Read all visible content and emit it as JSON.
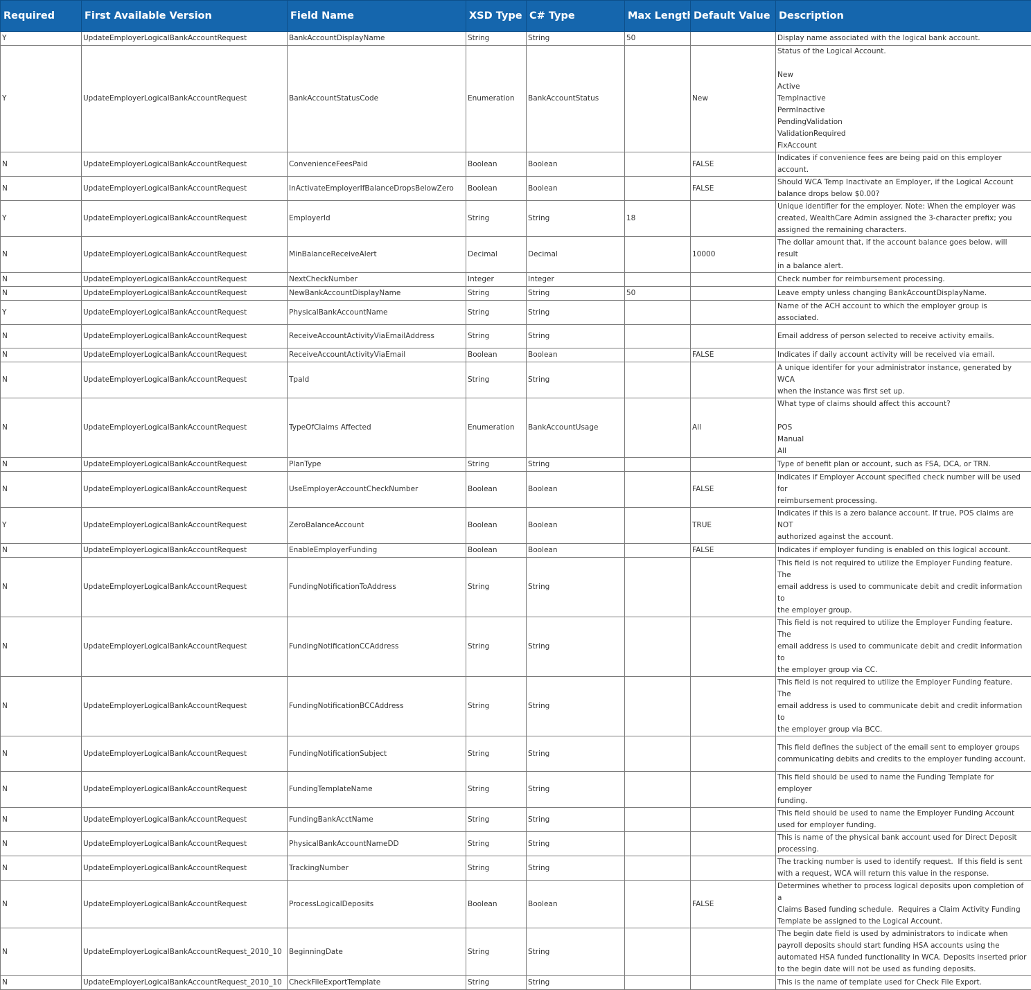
{
  "columns": [
    "Required",
    "First Available Version",
    "Field Name",
    "XSD Type",
    "C# Type",
    "Max Length",
    "Default Value",
    "Description"
  ],
  "rows": [
    {
      "h": 20,
      "cells": [
        "Y",
        "UpdateEmployerLogicalBankAccountRequest",
        "BankAccountDisplayName",
        "String",
        "String",
        "50",
        "",
        "Display name associated with the logical bank account."
      ]
    },
    {
      "h": 153,
      "cells": [
        "Y",
        "UpdateEmployerLogicalBankAccountRequest",
        "BankAccountStatusCode",
        "Enumeration",
        "BankAccountStatus",
        "",
        "New",
        "Status of the Logical Account.\n\nNew\nActive\nTempInactive\nPermInactive\nPendingValidation\nValidationRequired\nFixAccount"
      ]
    },
    {
      "h": 34,
      "cells": [
        "N",
        "UpdateEmployerLogicalBankAccountRequest",
        "ConvenienceFeesPaid",
        "Boolean",
        "Boolean",
        "",
        "FALSE",
        "Indicates if convenience fees are being paid on this employer account."
      ]
    },
    {
      "h": 34,
      "cells": [
        "N",
        "UpdateEmployerLogicalBankAccountRequest",
        "InActivateEmployerIfBalanceDropsBelowZero",
        "Boolean",
        "Boolean",
        "",
        "FALSE",
        "Should WCA Temp Inactivate an Employer, if the Logical Account\nbalance drops below $0.00?"
      ]
    },
    {
      "h": 51,
      "cells": [
        "Y",
        "UpdateEmployerLogicalBankAccountRequest",
        "EmployerId",
        "String",
        "String",
        "18",
        "",
        "Unique identifier for the employer. Note: When the employer was\ncreated, WealthCare Admin assigned the 3-character prefix; you\nassigned the remaining characters."
      ]
    },
    {
      "h": 34,
      "cells": [
        "N",
        "UpdateEmployerLogicalBankAccountRequest",
        "MinBalanceReceiveAlert",
        "Decimal",
        "Decimal",
        "",
        "10000",
        "The dollar amount that, if the account balance goes below, will result\nin a balance alert."
      ]
    },
    {
      "h": 20,
      "cells": [
        "N",
        "UpdateEmployerLogicalBankAccountRequest",
        "NextCheckNumber",
        "Integer",
        "Integer",
        "",
        "",
        "Check number for reimbursement processing."
      ]
    },
    {
      "h": 20,
      "cells": [
        "N",
        "UpdateEmployerLogicalBankAccountRequest",
        "NewBankAccountDisplayName",
        "String",
        "String",
        "50",
        "",
        "Leave empty unless changing BankAccountDisplayName."
      ]
    },
    {
      "h": 34,
      "cells": [
        "Y",
        "UpdateEmployerLogicalBankAccountRequest",
        "PhysicalBankAccountName",
        "String",
        "String",
        "",
        "",
        "Name of the ACH account to which the employer group is associated."
      ]
    },
    {
      "h": 34,
      "cells": [
        "N",
        "UpdateEmployerLogicalBankAccountRequest",
        "ReceiveAccountActivityViaEmailAddress",
        "String",
        "String",
        "",
        "",
        "Email address of person selected to receive activity emails."
      ]
    },
    {
      "h": 20,
      "cells": [
        "N",
        "UpdateEmployerLogicalBankAccountRequest",
        "ReceiveAccountActivityViaEmail",
        "Boolean",
        "Boolean",
        "",
        "FALSE",
        "Indicates if daily account activity will be received via email."
      ]
    },
    {
      "h": 34,
      "cells": [
        "N",
        "UpdateEmployerLogicalBankAccountRequest",
        "TpaId",
        "String",
        "String",
        "",
        "",
        "A unique identifer for your administrator instance, generated by WCA\nwhen the instance was first set up."
      ]
    },
    {
      "h": 85,
      "cells": [
        "N",
        "UpdateEmployerLogicalBankAccountRequest",
        "TypeOfClaims Affected",
        "Enumeration",
        "BankAccountUsage",
        "",
        "All",
        "What type of claims should affect this account?\n\nPOS\nManual\nAll"
      ]
    },
    {
      "h": 20,
      "cells": [
        "N",
        "UpdateEmployerLogicalBankAccountRequest",
        "PlanType",
        "String",
        "String",
        "",
        "",
        "Type of benefit plan or account, such as FSA, DCA, or TRN."
      ]
    },
    {
      "h": 34,
      "cells": [
        "N",
        "UpdateEmployerLogicalBankAccountRequest",
        "UseEmployerAccountCheckNumber",
        "Boolean",
        "Boolean",
        "",
        "FALSE",
        "Indicates if Employer Account specified check number will be used for\nreimbursement processing."
      ]
    },
    {
      "h": 34,
      "cells": [
        "Y",
        "UpdateEmployerLogicalBankAccountRequest",
        "ZeroBalanceAccount",
        "Boolean",
        "Boolean",
        "",
        "TRUE",
        "Indicates if this is a zero balance account. If true, POS claims are NOT\nauthorized against the account."
      ]
    },
    {
      "h": 20,
      "cells": [
        "N",
        "UpdateEmployerLogicalBankAccountRequest",
        "EnableEmployerFunding",
        "Boolean",
        "Boolean",
        "",
        "FALSE",
        "Indicates if employer funding is enabled on this logical account."
      ]
    },
    {
      "h": 51,
      "cells": [
        "N",
        "UpdateEmployerLogicalBankAccountRequest",
        "FundingNotificationToAddress",
        "String",
        "String",
        "",
        "",
        "This field is not required to utilize the Employer Funding feature.  The\nemail address is used to communicate debit and credit information to\nthe employer group."
      ]
    },
    {
      "h": 51,
      "cells": [
        "N",
        "UpdateEmployerLogicalBankAccountRequest",
        "FundingNotificationCCAddress",
        "String",
        "String",
        "",
        "",
        "This field is not required to utilize the Employer Funding feature.  The\nemail address is used to communicate debit and credit information to\nthe employer group via CC."
      ]
    },
    {
      "h": 51,
      "cells": [
        "N",
        "UpdateEmployerLogicalBankAccountRequest",
        "FundingNotificationBCCAddress",
        "String",
        "String",
        "",
        "",
        "This field is not required to utilize the Employer Funding feature.  The\nemail address is used to communicate debit and credit information to\nthe employer group via BCC."
      ]
    },
    {
      "h": 51,
      "cells": [
        "N",
        "UpdateEmployerLogicalBankAccountRequest",
        "FundingNotificationSubject",
        "String",
        "String",
        "",
        "",
        "This field defines the subject of the email sent to employer groups\ncommunicating debits and credits to the employer funding account."
      ]
    },
    {
      "h": 34,
      "cells": [
        "N",
        "UpdateEmployerLogicalBankAccountRequest",
        "FundingTemplateName",
        "String",
        "String",
        "",
        "",
        "This field should be used to name the Funding Template for employer\nfunding."
      ]
    },
    {
      "h": 34,
      "cells": [
        "N",
        "UpdateEmployerLogicalBankAccountRequest",
        "FundingBankAcctName",
        "String",
        "String",
        "",
        "",
        "This field should be used to name the Employer Funding Account\nused for employer funding."
      ]
    },
    {
      "h": 34,
      "cells": [
        "N",
        "UpdateEmployerLogicalBankAccountRequest",
        "PhysicalBankAccountNameDD",
        "String",
        "String",
        "",
        "",
        "This is name of the physical bank account used for Direct Deposit\nprocessing."
      ]
    },
    {
      "h": 34,
      "cells": [
        "N",
        "UpdateEmployerLogicalBankAccountRequest",
        "TrackingNumber",
        "String",
        "String",
        "",
        "",
        "The tracking number is used to identify request.  If this field is sent\nwith a request, WCA will return this value in the response."
      ]
    },
    {
      "h": 51,
      "cells": [
        "N",
        "UpdateEmployerLogicalBankAccountRequest",
        "ProcessLogicalDeposits",
        "Boolean",
        "Boolean",
        "",
        "FALSE",
        "Determines whether to process logical deposits upon completion of a\nClaims Based funding schedule.  Requires a Claim Activity Funding\nTemplate be assigned to the Logical Account."
      ]
    },
    {
      "h": 68,
      "cells": [
        "N",
        "UpdateEmployerLogicalBankAccountRequest_2010_10",
        "BeginningDate",
        "String",
        "String",
        "",
        "",
        "The begin date field is used by administrators to indicate when\npayroll deposits should start funding HSA accounts using the\nautomated HSA funded functionality in WCA. Deposits inserted prior\nto the begin date will not be used as funding deposits."
      ]
    },
    {
      "h": 20,
      "cells": [
        "N",
        "UpdateEmployerLogicalBankAccountRequest_2010_10",
        "CheckFileExportTemplate",
        "String",
        "String",
        "",
        "",
        "This is the name of template used for Check File Export."
      ]
    }
  ]
}
